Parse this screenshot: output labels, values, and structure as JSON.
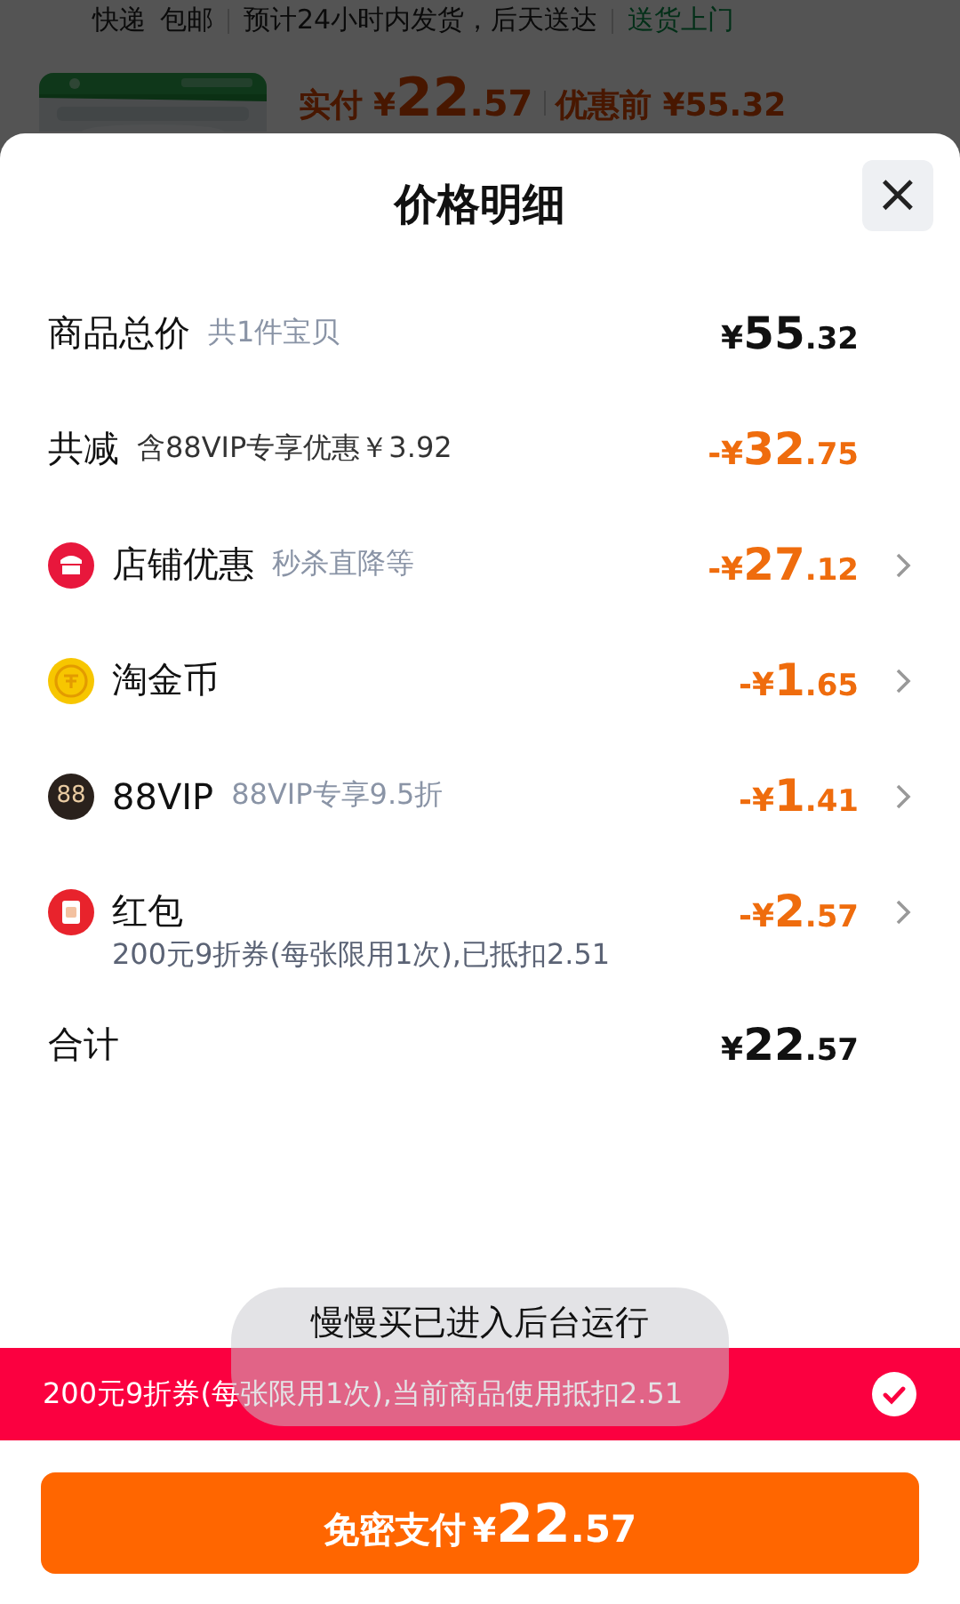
{
  "background_page": {
    "shipping": [
      "快递",
      "包邮",
      "预计24小时内发货，后天送达"
    ],
    "delivery_tag": "送货上门",
    "product": {
      "paid_label": "实付",
      "paid_prefix": "¥",
      "paid_main": "22",
      "paid_fraction": ".57",
      "original_label": "优惠前",
      "original_price": "¥55.32"
    }
  },
  "sheet": {
    "title": "价格明细",
    "close_icon": "×"
  },
  "rows": [
    {
      "kind": "total",
      "label": "商品总价",
      "note": "共1件宝贝",
      "prefix": "¥",
      "main": "55",
      "fraction": ".32"
    },
    {
      "kind": "reduction",
      "label": "共减",
      "note": "含88VIP专享优惠￥3.92",
      "prefix": "-¥",
      "main": "32",
      "fraction": ".75"
    },
    {
      "kind": "store",
      "label": "店铺优惠",
      "note": "秒杀直降等",
      "prefix": "-¥",
      "main": "27",
      "fraction": ".12"
    },
    {
      "kind": "coin",
      "label": "淘金币",
      "prefix": "-¥",
      "main": "1",
      "fraction": ".65"
    },
    {
      "kind": "vip",
      "badge": "88",
      "label": "88VIP",
      "note": "88VIP专享9.5折",
      "prefix": "-¥",
      "main": "1",
      "fraction": ".41"
    },
    {
      "kind": "packet",
      "label": "红包",
      "detail": "200元9折券(每张限用1次),已抵扣2.51",
      "prefix": "-¥",
      "main": "2",
      "fraction": ".57"
    },
    {
      "kind": "total",
      "label": "合计",
      "prefix": "¥",
      "main": "22",
      "fraction": ".57"
    }
  ],
  "coupon_bar": {
    "text": "200元9折券(每张限用1次),当前商品使用抵扣2.51",
    "checked": true
  },
  "pay_button": {
    "label": "免密支付",
    "prefix": "¥",
    "main": "22",
    "fraction": ".57"
  },
  "toast": {
    "text": "慢慢买已进入后台运行"
  }
}
